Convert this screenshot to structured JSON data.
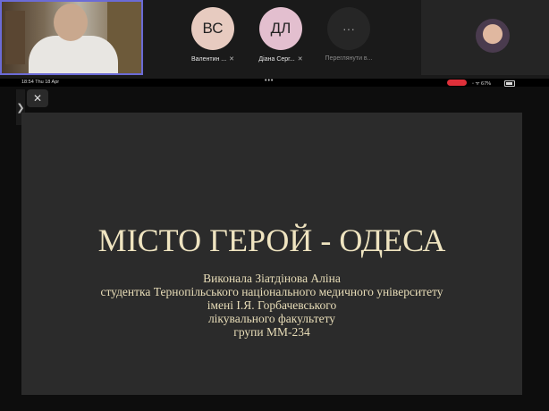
{
  "participants": [
    {
      "initials": "ВС",
      "name": "Валентин ...",
      "color": "#e7cbc0"
    },
    {
      "initials": "ДЛ",
      "name": "Діана Серг...",
      "color": "#e3bfcf"
    }
  ],
  "more_participants": {
    "icon": "···",
    "label": "Переглянути в..."
  },
  "statusbar": {
    "time": "18:54",
    "date": "Thu 18 Apr",
    "dots": "•••",
    "battery": "◦ ᯤ 67%"
  },
  "controls": {
    "close": "✕",
    "sidebar_toggle": "❯"
  },
  "slide": {
    "title": "МІСТО ГЕРОЙ - ОДЕСА",
    "lines": [
      "Виконала Зіатдінова Аліна",
      "студентка Тернопільського національного медичного університету",
      "імені І.Я. Горбачевського",
      "лікувального факультету",
      "групи ММ-234"
    ]
  }
}
